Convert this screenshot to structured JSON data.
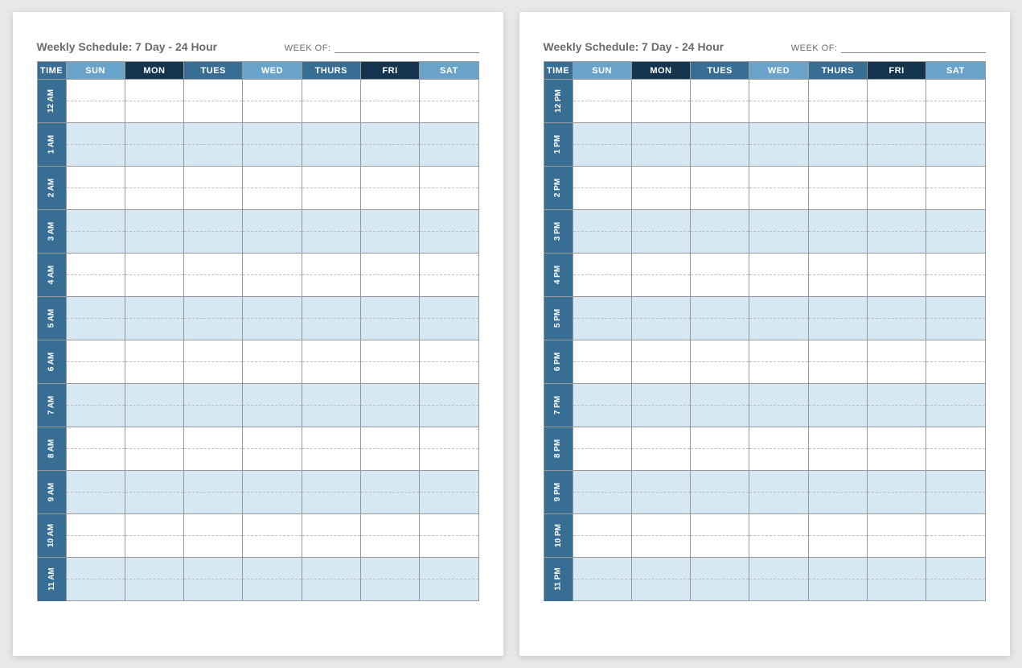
{
  "title": "Weekly Schedule: 7 Day - 24 Hour",
  "week_of_label": "WEEK OF:",
  "columns": {
    "time": "TIME",
    "days": [
      "SUN",
      "MON",
      "TUES",
      "WED",
      "THURS",
      "FRI",
      "SAT"
    ]
  },
  "day_header_classes": [
    "hdr-sun",
    "hdr-mon",
    "hdr-tues",
    "hdr-wed",
    "hdr-thurs",
    "hdr-fri",
    "hdr-sat"
  ],
  "pages": [
    {
      "hours": [
        "12 AM",
        "1 AM",
        "2 AM",
        "3 AM",
        "4 AM",
        "5 AM",
        "6 AM",
        "7 AM",
        "8 AM",
        "9 AM",
        "10 AM",
        "11 AM"
      ]
    },
    {
      "hours": [
        "12 PM",
        "1 PM",
        "2 PM",
        "3 PM",
        "4 PM",
        "5 PM",
        "6 PM",
        "7 PM",
        "8 PM",
        "9 PM",
        "10 PM",
        "11 PM"
      ]
    }
  ]
}
